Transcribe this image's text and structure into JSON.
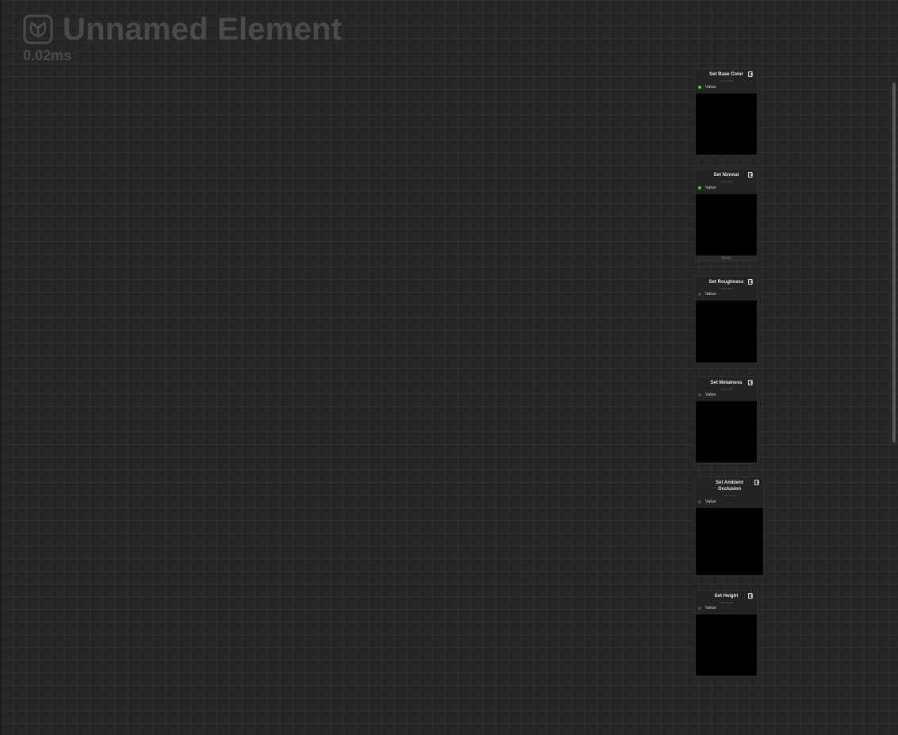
{
  "graph": {
    "title": "Unnamed Element",
    "timing": "0.02ms",
    "logo_icon": "node-graph-logo-icon"
  },
  "colors": {
    "background": "#262626",
    "header_text": "#4a4a4a",
    "connected_pin": "#4cd137",
    "preview": "#000000"
  },
  "nodes": [
    {
      "title": "Set Base Color",
      "subtitle": "0.01 / 0.000",
      "pin_label": "Value",
      "pin_connected": true,
      "footer": ""
    },
    {
      "title": "Set Normal",
      "subtitle": "0.01 / 0.000",
      "pin_label": "Value",
      "pin_connected": true,
      "footer": "Error"
    },
    {
      "title": "Set Roughness",
      "subtitle": "0.01 / 0.000",
      "pin_label": "Value",
      "pin_connected": false,
      "footer": ""
    },
    {
      "title": "Set Metalness",
      "subtitle": "0.01 / 0.000",
      "pin_label": "Value",
      "pin_connected": false,
      "footer": ""
    },
    {
      "title": "Set Ambient Occlusion",
      "subtitle": "0.01 / 0.000",
      "pin_label": "Value",
      "pin_connected": false,
      "footer": ""
    },
    {
      "title": "Set Height",
      "subtitle": "0.01 / 0.000",
      "pin_label": "Value",
      "pin_connected": false,
      "footer": ""
    }
  ]
}
